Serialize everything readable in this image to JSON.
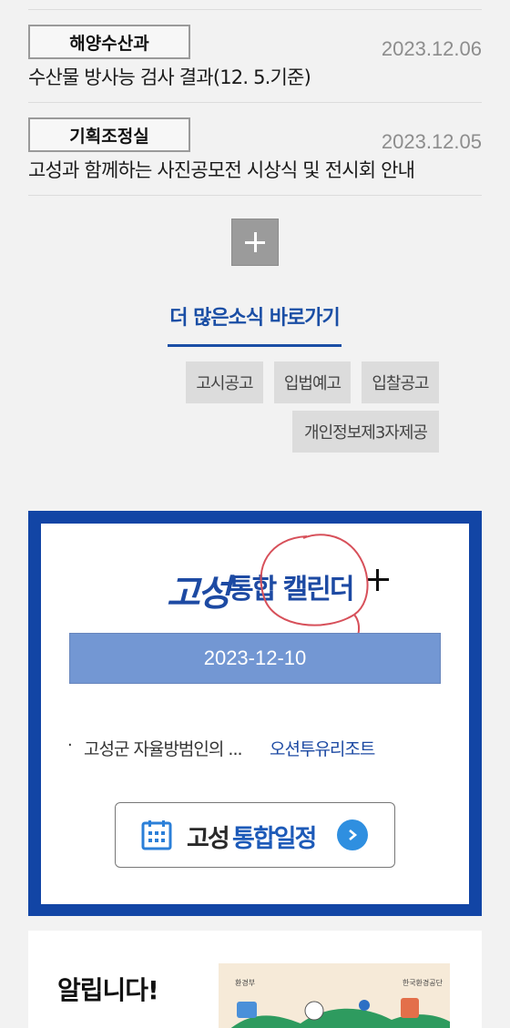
{
  "news": [
    {
      "department": "해양수산과",
      "date": "2023.12.06",
      "title": "수산물 방사능 검사 결과(12. 5.기준)"
    },
    {
      "department": "기획조정실",
      "date": "2023.12.05",
      "title": "고성과 함께하는 사진공모전 시상식 및 전시회 안내"
    }
  ],
  "more": {
    "label": "더 많은소식 바로가기"
  },
  "quick_links": [
    "고시공고",
    "입법예고",
    "입찰공고",
    "개인정보제3자제공"
  ],
  "calendar": {
    "logo_text": "고성",
    "title": "통합 캘린더",
    "date": "2023-12-10",
    "event_text": "고성군 자율방범인의 ...",
    "event_place": "오션투유리조트",
    "button_label_part1": "고성",
    "button_label_part2": "통합일정",
    "colors": {
      "frame": "#1245a5",
      "date_bar": "#7397d3",
      "accent": "#1d4aa3"
    }
  },
  "notice": {
    "title": "알립니다!",
    "banner_left_label": "환경부",
    "banner_right_label": "한국환경공단"
  }
}
